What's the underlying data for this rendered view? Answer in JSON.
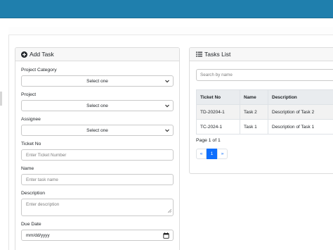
{
  "add_task": {
    "title": "Add Task",
    "fields": {
      "project_category": {
        "label": "Project Category",
        "value": "Select one"
      },
      "project": {
        "label": "Project",
        "value": "Select one"
      },
      "assignee": {
        "label": "Assignee",
        "value": "Select one"
      },
      "ticket_no": {
        "label": "Ticket No",
        "placeholder": "Enter Ticket Number"
      },
      "name": {
        "label": "Name",
        "placeholder": "Enter task name"
      },
      "description": {
        "label": "Description",
        "placeholder": "Enter description"
      },
      "due_date": {
        "label": "Due Date",
        "value": "mm/dd/yyyy"
      }
    }
  },
  "tasks_list": {
    "title": "Tasks List",
    "search_placeholder": "Search by name",
    "columns": [
      "Ticket No",
      "Name",
      "Description"
    ],
    "rows": [
      [
        "TD-20204-1",
        "Task 2",
        "Description of Task 2"
      ],
      [
        "TC-2024-1",
        "Task 1",
        "Description of Task 1"
      ]
    ],
    "page_info": "Page 1 of 1",
    "pagination": {
      "prev": "«",
      "current": "1",
      "next": "»"
    }
  },
  "colors": {
    "topbar": "#1f7fad",
    "primary": "#0d6efd"
  },
  "icons": {
    "add": "plus-circle-icon",
    "list": "list-icon",
    "dropdown": "chevron-down-icon",
    "date": "calendar-icon"
  }
}
